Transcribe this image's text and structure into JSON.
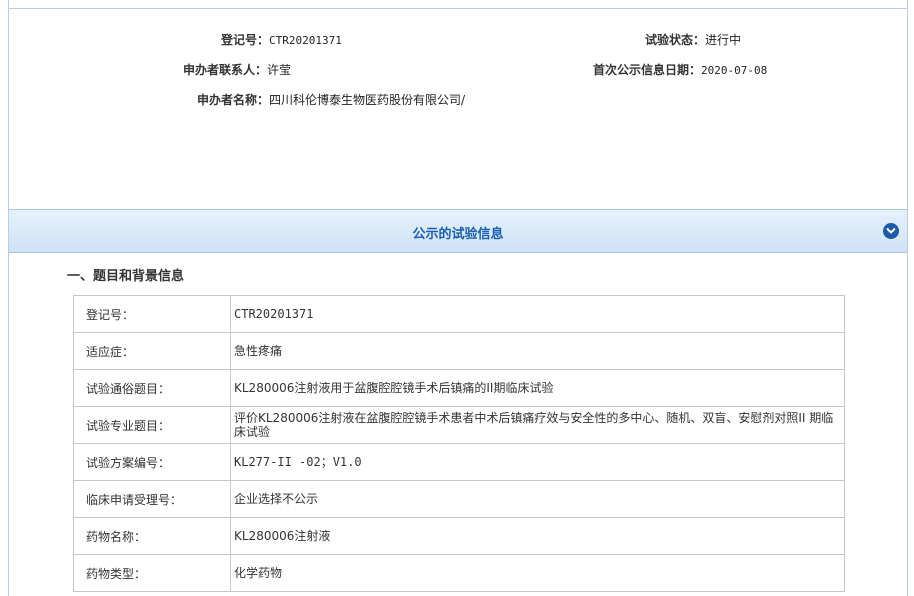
{
  "header": {
    "reg_no_label": "登记号：",
    "reg_no_value": "CTR20201371",
    "status_label": "试验状态：",
    "status_value": "进行中",
    "contact_label": "申办者联系人：",
    "contact_value": "许莹",
    "first_pub_label": "首次公示信息日期：",
    "first_pub_value": "2020-07-08",
    "sponsor_label": "申办者名称：",
    "sponsor_value": "四川科伦博泰生物医药股份有限公司/"
  },
  "banner": {
    "title": "公示的试验信息",
    "toggle_icon": "chevron-down-circle-icon",
    "color": "#1d5aa8"
  },
  "section": {
    "title": "一、题目和背景信息"
  },
  "table": {
    "rows": [
      {
        "label": "登记号：",
        "value": "CTR20201371"
      },
      {
        "label": "适应症：",
        "value": "急性疼痛"
      },
      {
        "label": "试验通俗题目：",
        "value": "KL280006注射液用于盆腹腔腔镜手术后镇痛的II期临床试验"
      },
      {
        "label": "试验专业题目：",
        "value": "评价KL280006注射液在盆腹腔腔镜手术患者中术后镇痛疗效与安全性的多中心、随机、双盲、安慰剂对照II 期临床试验"
      },
      {
        "label": "试验方案编号：",
        "value": "KL277-II -02；V1.0"
      },
      {
        "label": "临床申请受理号：",
        "value": "企业选择不公示"
      },
      {
        "label": "药物名称：",
        "value": "KL280006注射液"
      },
      {
        "label": "药物类型：",
        "value": "化学药物"
      }
    ]
  }
}
